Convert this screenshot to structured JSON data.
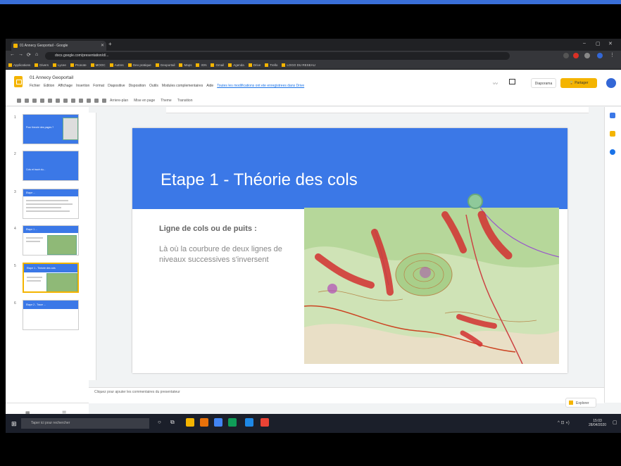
{
  "browser": {
    "tab_title": "01 Annecy Geoportail - Google",
    "url": "docs.google.com/presentation/d/...",
    "bookmarks": [
      "Applications",
      "Divers",
      "Lycee",
      "Pronote",
      "MOOC",
      "Autres",
      "Geo pratique",
      "Geoportail",
      "Maps",
      "IGN",
      "Gmail",
      "Agenda",
      "Drive",
      "Trello",
      "LOGO DU RESEAU"
    ]
  },
  "slides_app": {
    "doc_title": "01 Annecy Geoportail",
    "menu": [
      "Fichier",
      "Edition",
      "Affichage",
      "Insertion",
      "Format",
      "Diapositive",
      "Disposition",
      "Outils",
      "Modules complementaires",
      "Aide"
    ],
    "last_edit": "Toutes les modifications ont ete enregistrees dans Drive",
    "toolbar": [
      "Arriere-plan",
      "Mise en page",
      "Theme",
      "Transition"
    ],
    "present_label": "Diaporama",
    "share_label": "Partager",
    "notes_placeholder": "Cliquez pour ajouter les commentaires du presentateur",
    "explore_label": "Explorer"
  },
  "thumbnails": [
    {
      "num": "1",
      "title": "Pour theorie des pages ?"
    },
    {
      "num": "2",
      "title": "Cols et tracé du..."
    },
    {
      "num": "3",
      "title": "Etape ..."
    },
    {
      "num": "4",
      "title": "Etape 1 ..."
    },
    {
      "num": "5",
      "title": "Etape 1 - Théorie des cols"
    },
    {
      "num": "6",
      "title": "Etape 2 - Trace ..."
    }
  ],
  "slide": {
    "title": "Etape 1 - Théorie des cols",
    "subtitle": "Ligne de cols ou de puits :",
    "body": "Là où la courbure de deux lignes de niveaux successives s'inversent"
  },
  "taskbar": {
    "search_placeholder": "Taper ici pour rechercher",
    "time": "15:03",
    "date": "28/04/2020"
  },
  "colors": {
    "slide_banner": "#3b78e7",
    "share_button": "#f4b400",
    "selected_thumb": "#f4b400"
  }
}
